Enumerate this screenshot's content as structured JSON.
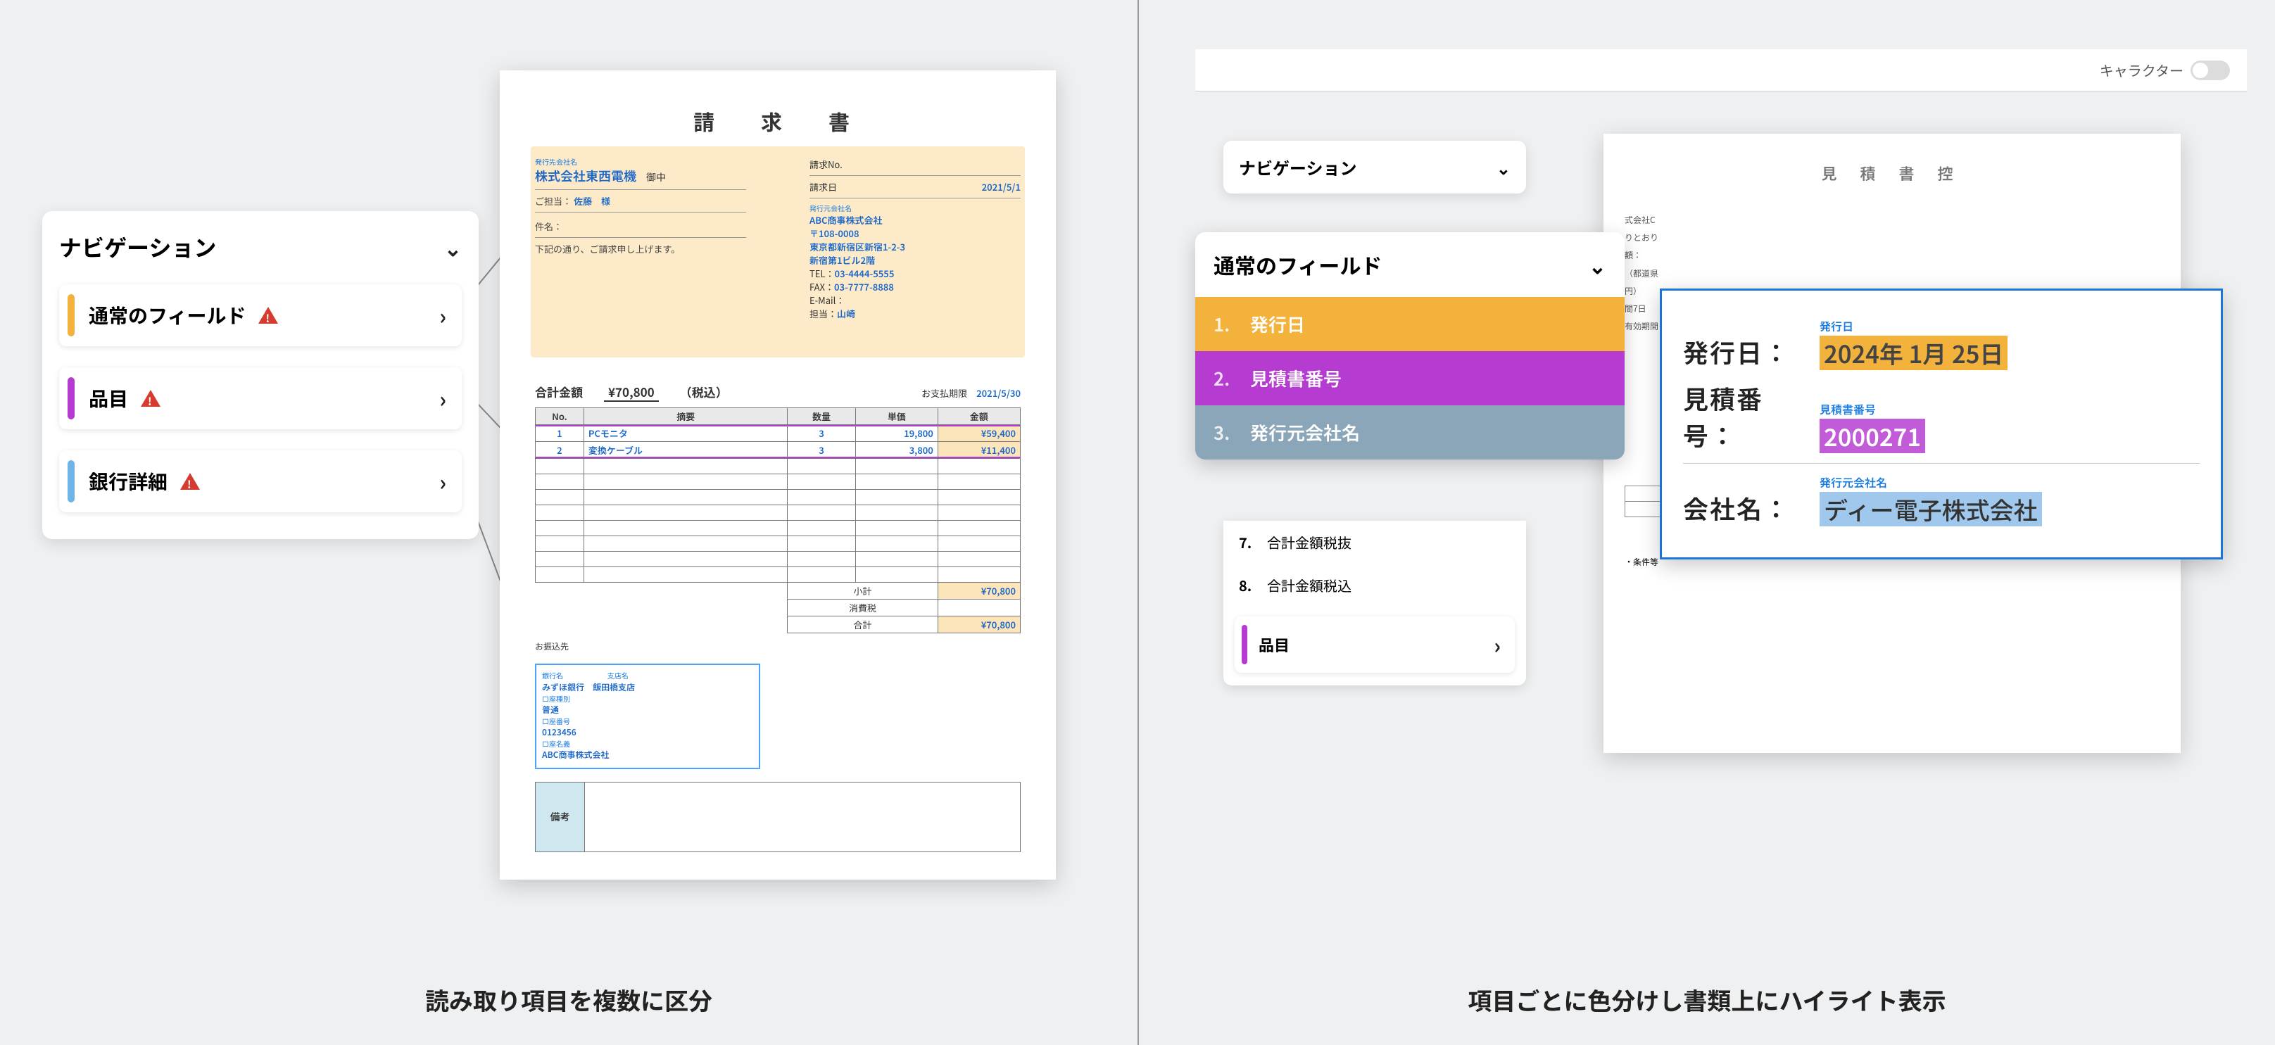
{
  "left": {
    "nav_title": "ナビゲーション",
    "items": [
      {
        "label": "通常のフィールド",
        "color": "#f2b23c"
      },
      {
        "label": "品目",
        "color": "#b53bd1"
      },
      {
        "label": "銀行詳細",
        "color": "#6fb4e8"
      }
    ],
    "caption": "読み取り項目を複数に区分",
    "invoice": {
      "title": "請　求　書",
      "buyer_tag": "発行先会社名",
      "buyer": "株式会社東西電機",
      "onchu": "御中",
      "contact_label": "ご担当：",
      "contact": "佐藤　様",
      "no_label": "請求No.",
      "no_val": "",
      "date_label": "請求日",
      "date_val": "2021/5/1",
      "subject_label": "件名：",
      "note": "下記の通り、ご請求申し上げます。",
      "issuer_tag": "発行元会社名",
      "issuer": "ABC商事株式会社",
      "postal": "〒108-0008",
      "addr1": "東京都新宿区新宿1-2-3",
      "addr2": "新宿第1ビル2階",
      "tel_label": "TEL：",
      "tel": "03-4444-5555",
      "fax_label": "FAX：",
      "fax": "03-7777-8888",
      "mail_label": "E-Mail：",
      "person_label": "担当：",
      "person": "山崎",
      "total_label": "合計金額",
      "total": "¥70,800",
      "taxincl": "（税込）",
      "due_label": "お支払期限",
      "due": "2021/5/30",
      "th": {
        "no": "No.",
        "desc": "摘要",
        "qty": "数量",
        "unit": "単価",
        "amount": "金額"
      },
      "rows": [
        {
          "no": "1",
          "desc": "PCモニタ",
          "qty": "3",
          "unit": "19,800",
          "amount": "¥59,400"
        },
        {
          "no": "2",
          "desc": "変換ケーブル",
          "qty": "3",
          "unit": "3,800",
          "amount": "¥11,400"
        }
      ],
      "subtotal_label": "小計",
      "subtotal": "¥70,800",
      "tax_label": "消費税",
      "grand_label": "合計",
      "grand": "¥70,800",
      "bank_head": "お振込先",
      "bank_name_tag": "銀行名",
      "bank_name": "みずほ銀行",
      "branch_tag": "支店名",
      "branch": "飯田橋支店",
      "acct_type_tag": "口座種別",
      "acct_type": "普通",
      "acct_no_tag": "口座番号",
      "acct_no": "0123456",
      "acct_name_tag": "口座名義",
      "acct_name": "ABC商事株式会社",
      "remark_label": "備考"
    }
  },
  "right": {
    "character_label": "キャラクター",
    "nav_title": "ナビゲーション",
    "fields_title": "通常のフィールド",
    "fields": [
      {
        "n": "1.",
        "label": "発行日",
        "bg": "#f2b23c"
      },
      {
        "n": "2.",
        "label": "見積書番号",
        "bg": "#b53bd1"
      },
      {
        "n": "3.",
        "label": "発行元会社名",
        "bg": "#8aa6b8"
      }
    ],
    "tail": [
      {
        "n": "7.",
        "label": "合計金額税抜"
      },
      {
        "n": "8.",
        "label": "合計金額税込"
      }
    ],
    "items_label": "品目",
    "quote_title": "見 積 書 控",
    "quote_left": [
      "式会社C",
      "りとおり",
      "額：",
      "（都道県",
      "円）",
      "間7日",
      "有効期間"
    ],
    "callout": {
      "rows": [
        {
          "label": "発行日：",
          "tag": "発行日",
          "value": "2024年 1月 25日",
          "cls": "orange"
        },
        {
          "label": "見積番号：",
          "tag": "見積書番号",
          "value": "2000271",
          "cls": "purple"
        },
        {
          "label": "会社名：",
          "tag": "発行元会社名",
          "value": "ディー電子株式会社",
          "cls": "blue"
        }
      ]
    },
    "caption": "項目ごとに色分けし書類上にハイライト表示"
  }
}
